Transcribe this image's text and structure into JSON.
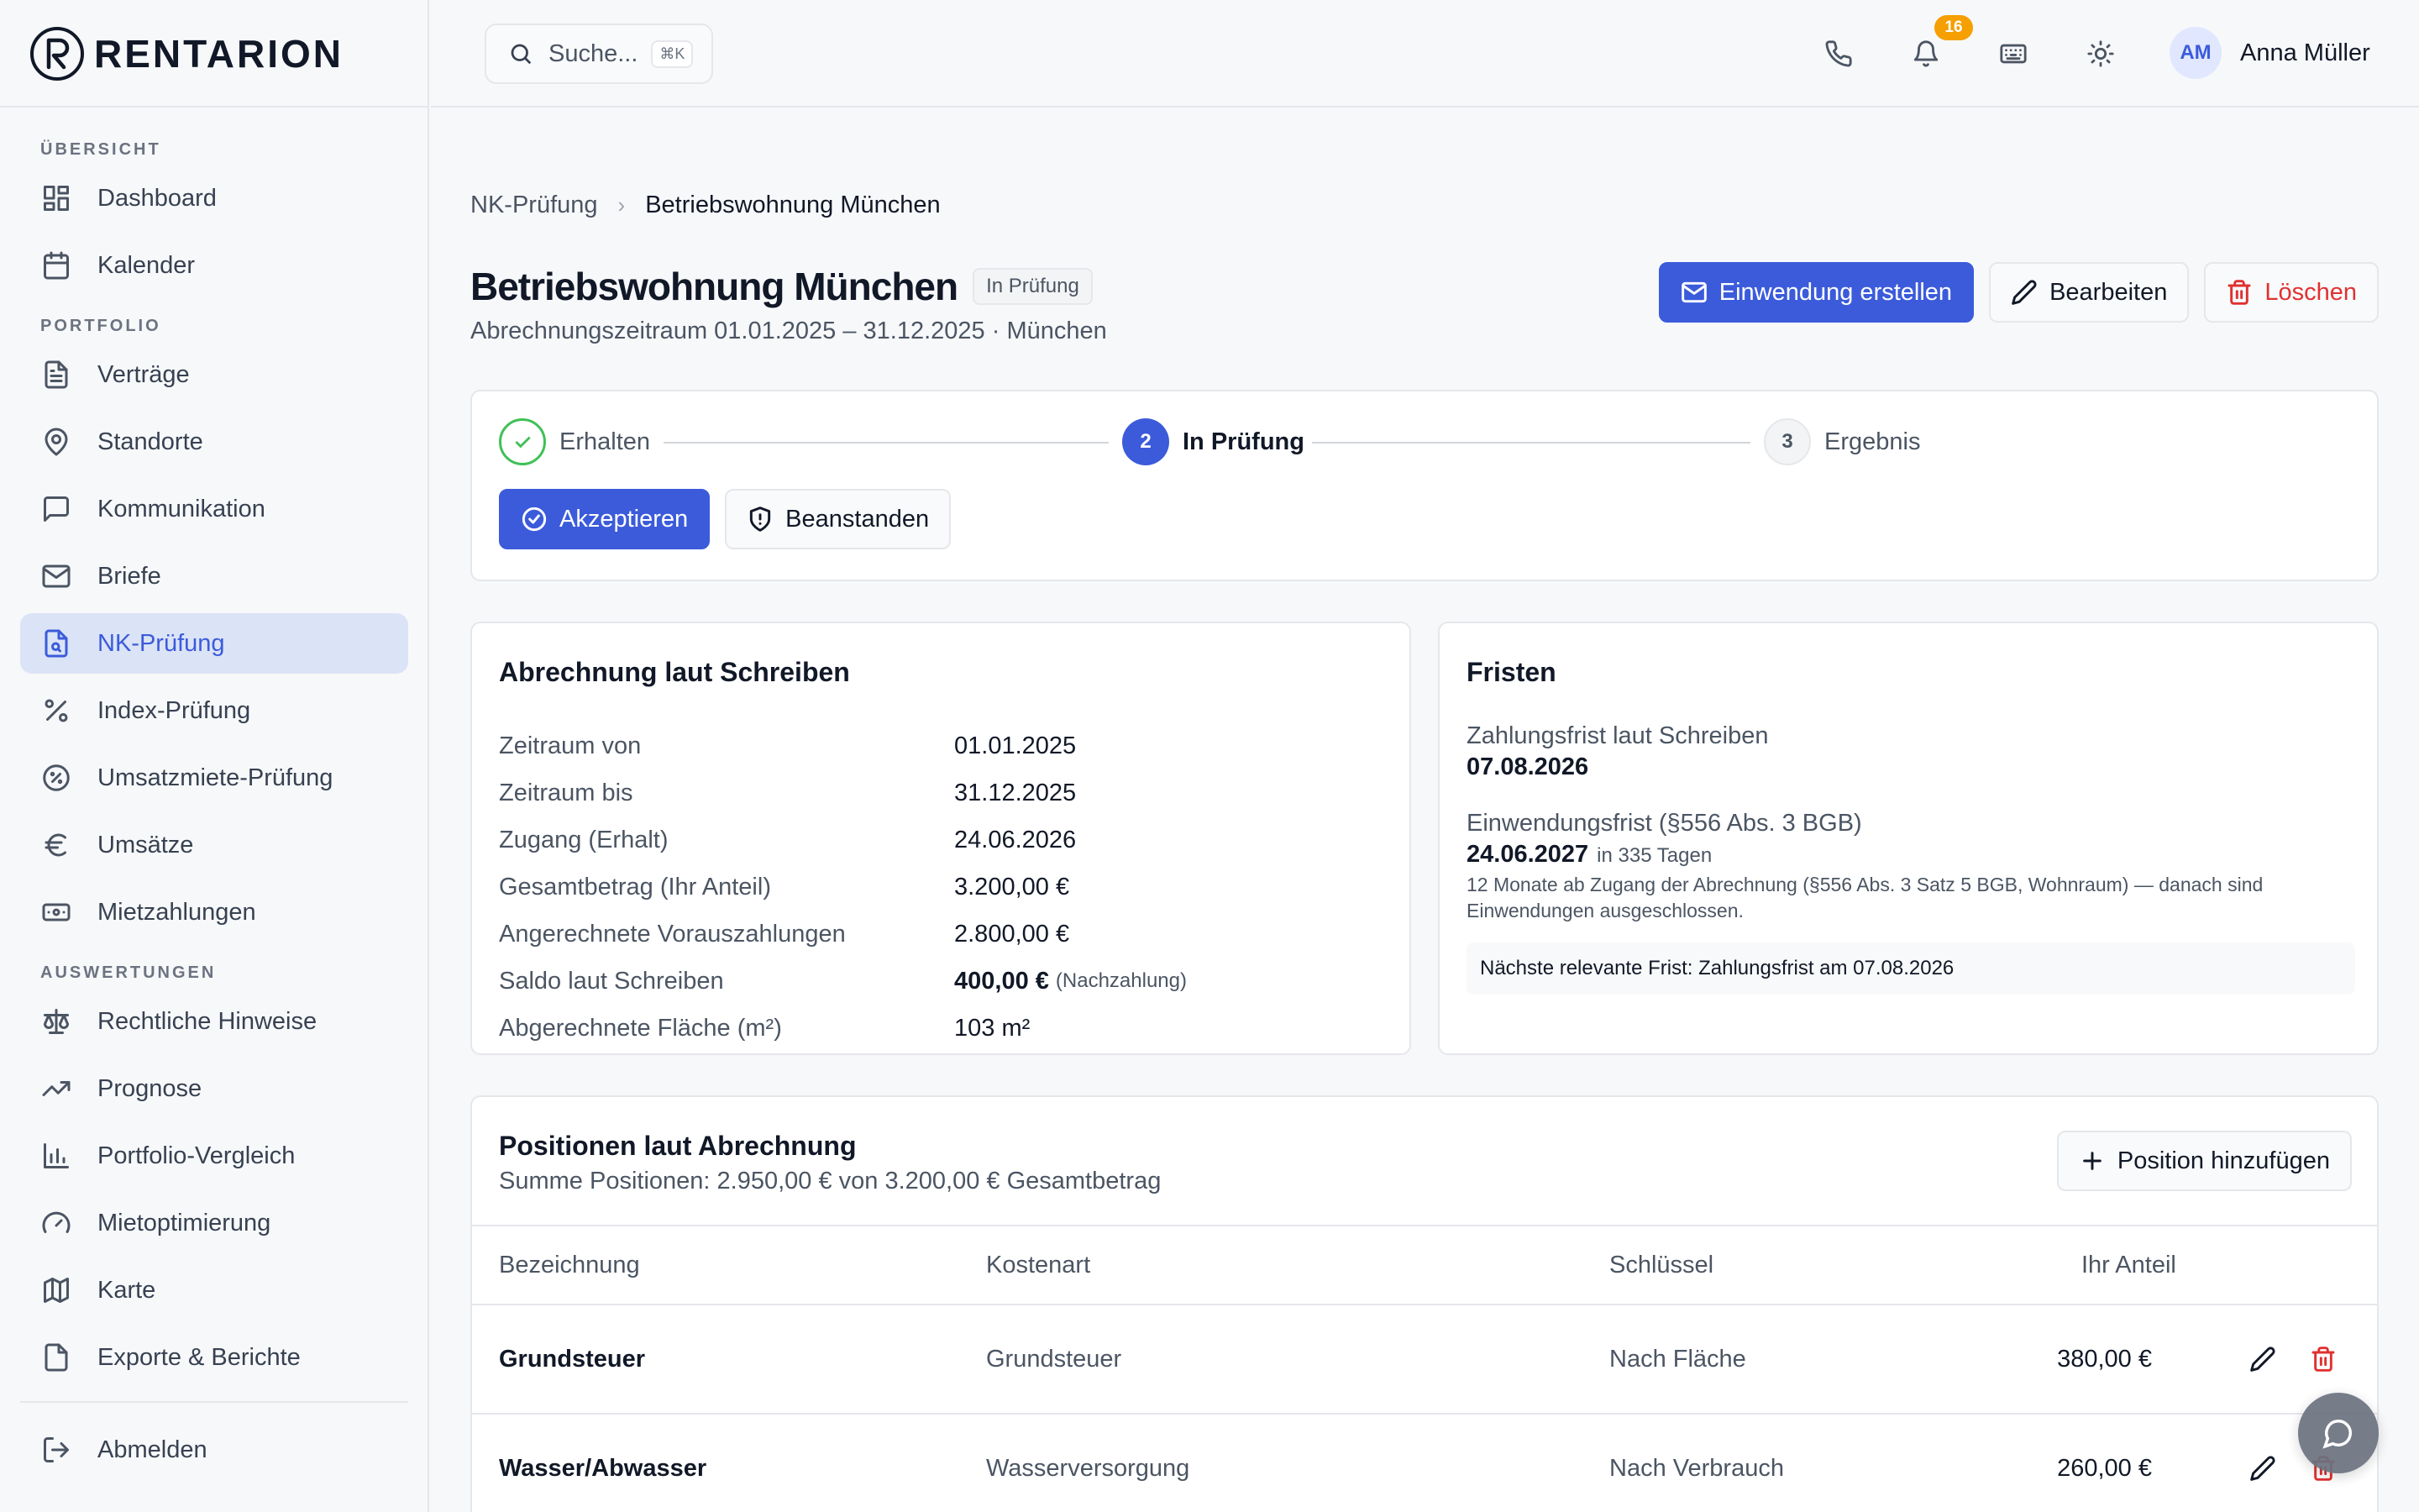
{
  "app": {
    "name": "RENTARION"
  },
  "search": {
    "placeholder": "Suche...",
    "shortcut": "⌘K"
  },
  "header": {
    "notifications_count": "16",
    "user_initials": "AM",
    "user_name": "Anna Müller"
  },
  "sidebar": {
    "sections": [
      {
        "title": "ÜBERSICHT",
        "items": [
          {
            "label": "Dashboard",
            "icon": "dashboard-icon"
          },
          {
            "label": "Kalender",
            "icon": "calendar-icon"
          }
        ]
      },
      {
        "title": "PORTFOLIO",
        "items": [
          {
            "label": "Verträge",
            "icon": "document-icon"
          },
          {
            "label": "Standorte",
            "icon": "map-pin-icon"
          },
          {
            "label": "Kommunikation",
            "icon": "chat-icon"
          },
          {
            "label": "Briefe",
            "icon": "mail-icon"
          },
          {
            "label": "NK-Prüfung",
            "icon": "file-search-icon",
            "active": true
          },
          {
            "label": "Index-Prüfung",
            "icon": "percent-icon"
          },
          {
            "label": "Umsatzmiete-Prüfung",
            "icon": "badge-percent-icon"
          },
          {
            "label": "Umsätze",
            "icon": "euro-icon"
          },
          {
            "label": "Mietzahlungen",
            "icon": "banknote-icon"
          }
        ]
      },
      {
        "title": "AUSWERTUNGEN",
        "items": [
          {
            "label": "Rechtliche Hinweise",
            "icon": "scale-icon"
          },
          {
            "label": "Prognose",
            "icon": "trending-up-icon"
          },
          {
            "label": "Portfolio-Vergleich",
            "icon": "bar-chart-icon"
          },
          {
            "label": "Mietoptimierung",
            "icon": "gauge-icon"
          },
          {
            "label": "Karte",
            "icon": "map-icon"
          },
          {
            "label": "Exporte & Berichte",
            "icon": "file-export-icon"
          }
        ]
      }
    ],
    "logout_label": "Abmelden"
  },
  "breadcrumb": {
    "parent": "NK-Prüfung",
    "current": "Betriebswohnung München"
  },
  "page": {
    "title": "Betriebswohnung München",
    "status": "In Prüfung",
    "subtitle": "Abrechnungszeitraum 01.01.2025 – 31.12.2025 · München"
  },
  "actions": {
    "objection": "Einwendung erstellen",
    "edit": "Bearbeiten",
    "delete": "Löschen"
  },
  "stepper": {
    "steps": [
      {
        "number": "1",
        "label": "Erhalten",
        "state": "done"
      },
      {
        "number": "2",
        "label": "In Prüfung",
        "state": "active"
      },
      {
        "number": "3",
        "label": "Ergebnis",
        "state": "todo"
      }
    ],
    "accept_label": "Akzeptieren",
    "contest_label": "Beanstanden"
  },
  "abrechnung": {
    "title": "Abrechnung laut Schreiben",
    "rows": [
      {
        "key": "Zeitraum von",
        "value": "01.01.2025"
      },
      {
        "key": "Zeitraum bis",
        "value": "31.12.2025"
      },
      {
        "key": "Zugang (Erhalt)",
        "value": "24.06.2026"
      },
      {
        "key": "Gesamtbetrag (Ihr Anteil)",
        "value": "3.200,00 €"
      },
      {
        "key": "Angerechnete Vorauszahlungen",
        "value": "2.800,00 €"
      },
      {
        "key": "Saldo laut Schreiben",
        "value": "400,00 €",
        "note": "(Nachzahlung)"
      },
      {
        "key": "Abgerechnete Fläche (m²)",
        "value": "103 m²"
      }
    ]
  },
  "fristen": {
    "title": "Fristen",
    "payment_label": "Zahlungsfrist laut Schreiben",
    "payment_date": "07.08.2026",
    "objection_label": "Einwendungsfrist (§556 Abs. 3 BGB)",
    "objection_date": "24.06.2027",
    "objection_days": "in 335 Tagen",
    "objection_help": "12 Monate ab Zugang der Abrechnung (§556 Abs. 3 Satz 5 BGB, Wohnraum) — danach sind Einwendungen ausgeschlossen.",
    "next_deadline": "Nächste relevante Frist: Zahlungsfrist am 07.08.2026"
  },
  "positionen": {
    "title": "Positionen laut Abrechnung",
    "summary": "Summe Positionen: 2.950,00 € von 3.200,00 € Gesamtbetrag",
    "add_label": "Position hinzufügen",
    "columns": {
      "name": "Bezeichnung",
      "type": "Kostenart",
      "key": "Schlüssel",
      "share": "Ihr Anteil"
    },
    "rows": [
      {
        "name": "Grundsteuer",
        "type": "Grundsteuer",
        "key": "Nach Fläche",
        "share": "380,00 €"
      },
      {
        "name": "Wasser/Abwasser",
        "type": "Wasserversorgung",
        "key": "Nach Verbrauch",
        "share": "260,00 €"
      }
    ]
  },
  "colors": {
    "primary": "#3b5bdb",
    "danger": "#e03131",
    "success": "#40c057",
    "badge": "#f59f00"
  }
}
